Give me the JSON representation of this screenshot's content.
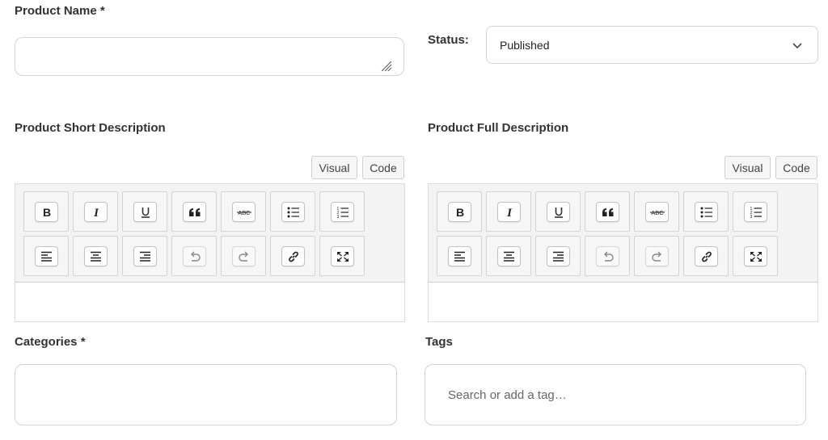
{
  "product_name": {
    "label": "Product Name *",
    "value": ""
  },
  "status": {
    "label": "Status:",
    "selected": "Published"
  },
  "short_description": {
    "label": "Product Short Description",
    "visual_label": "Visual",
    "code_label": "Code"
  },
  "full_description": {
    "label": "Product Full Description",
    "visual_label": "Visual",
    "code_label": "Code"
  },
  "toolbar": {
    "row1": [
      {
        "name": "bold-button",
        "icon": "bold-icon",
        "glyph": "B"
      },
      {
        "name": "italic-button",
        "icon": "italic-icon",
        "glyph": "I"
      },
      {
        "name": "underline-button",
        "icon": "underline-icon",
        "glyph": "U"
      },
      {
        "name": "blockquote-button",
        "icon": "quote-icon",
        "glyph": "“"
      },
      {
        "name": "strikethrough-button",
        "icon": "strikethrough-icon",
        "glyph": "ABC"
      },
      {
        "name": "bullet-list-button",
        "icon": "bullet-list-icon",
        "glyph": ""
      },
      {
        "name": "numbered-list-button",
        "icon": "numbered-list-icon",
        "glyph": ""
      }
    ],
    "row2": [
      {
        "name": "align-left-button",
        "icon": "align-left-icon"
      },
      {
        "name": "align-center-button",
        "icon": "align-center-icon"
      },
      {
        "name": "align-right-button",
        "icon": "align-right-icon"
      },
      {
        "name": "undo-button",
        "icon": "undo-icon"
      },
      {
        "name": "redo-button",
        "icon": "redo-icon"
      },
      {
        "name": "link-button",
        "icon": "link-icon"
      },
      {
        "name": "fullscreen-button",
        "icon": "fullscreen-icon"
      }
    ]
  },
  "categories": {
    "label": "Categories *",
    "value": ""
  },
  "tags": {
    "label": "Tags",
    "placeholder": "Search or add a tag…"
  },
  "colors": {
    "border": "#cfd4da",
    "toolbar_bg": "#f3f3f3",
    "text": "#333333"
  }
}
